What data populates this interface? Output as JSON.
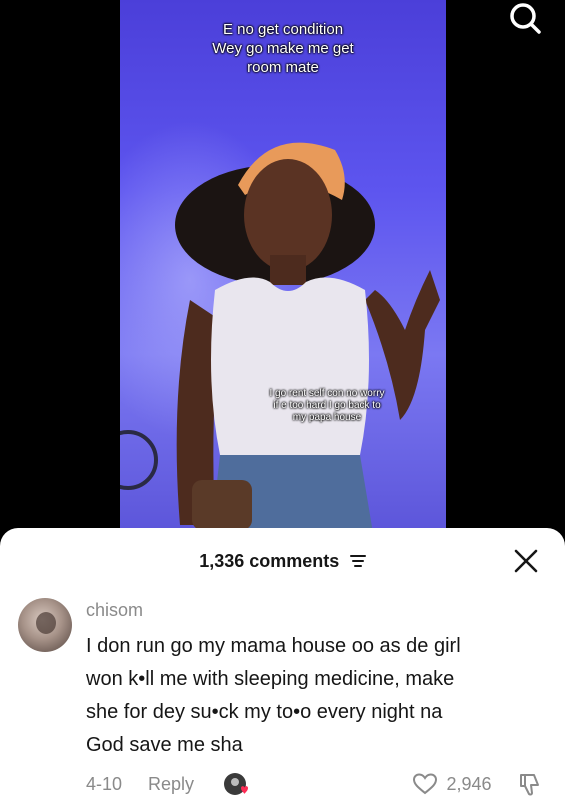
{
  "video": {
    "caption_lines": [
      "E no get condition",
      "Wey go make me get",
      "room mate"
    ],
    "overlay_lines": [
      "I go rent self con no worry",
      "if e too hard I go back to",
      "my papa house"
    ]
  },
  "top_bar": {
    "search_icon": "search-icon"
  },
  "comments_sheet": {
    "count_label": "1,336 comments",
    "filter_icon": "filter-icon",
    "close_icon": "close-icon"
  },
  "comment": {
    "username": "chisom",
    "text_lines": [
      "I don run go my mama house oo as de girl",
      "won k•ll me with sleeping medicine, make",
      "she for dey su•ck my to•o every night na",
      "God save me sha"
    ],
    "date": "4-10",
    "reply_label": "Reply",
    "like_count": "2,946",
    "icons": {
      "like": "heart-icon",
      "dislike": "thumbs-down-icon",
      "creator_liked": "creator-liked-avatar-icon"
    }
  },
  "colors": {
    "video_background": "#5d55ef",
    "sheet_background": "#ffffff",
    "primary_text": "#161616",
    "secondary_text": "#8a8a8a"
  }
}
